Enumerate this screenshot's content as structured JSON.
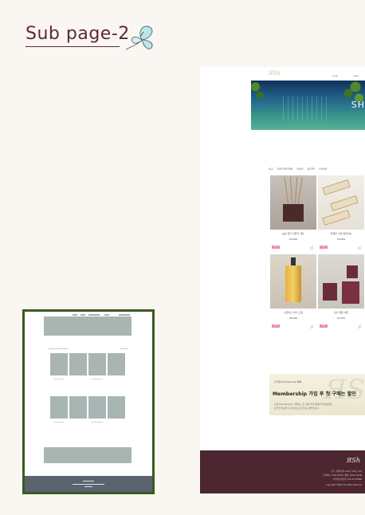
{
  "header": {
    "title": "Sub page-2",
    "icon": "butterfly-icon"
  },
  "page": {
    "logo": "ЯSh",
    "nav": [
      "shop",
      "login",
      "cart"
    ],
    "hero_text": "SH",
    "tabs": [
      "ALL",
      "BATHBOMB",
      "HAIR",
      "BODY",
      "HAND"
    ],
    "products": [
      {
        "name": "숲속 향기 디퓨저 세트",
        "price": "25,000",
        "badge": "BEST"
      },
      {
        "name": "라벤더 수제 천연비누",
        "price": "18,000",
        "badge": "NEW"
      },
      {
        "name": "시트러스 바디 오일",
        "price": "28,000",
        "badge": "BEST"
      },
      {
        "name": "소이 캔들 세트",
        "price": "32,000",
        "badge": "NEW"
      }
    ],
    "banner": {
      "small": "수익금 Membership 혜택",
      "big": "Membership 가입 후 첫 구매는 할인",
      "desc1": "지금 Membership 가입하고 첫 구매 할인 혜택을 받아보세요.",
      "desc2": "향긋한 일상을 더 합리적으로 즐기는 방법입니다."
    },
    "footer": {
      "logo": "ЯSh",
      "lines": [
        "주소: 서울특별시 OO구 OO로 123",
        "고객센터: 1234-5678 / 평일 10:00-18:00",
        "사업자등록번호 123-45-67890",
        "copyright ©ЯSh all rights reserved"
      ]
    }
  },
  "colors": {
    "accent": "#5a2a3a",
    "frame": "#3d5a1e",
    "badge": "#e98aa9",
    "footer": "#4c2630"
  }
}
